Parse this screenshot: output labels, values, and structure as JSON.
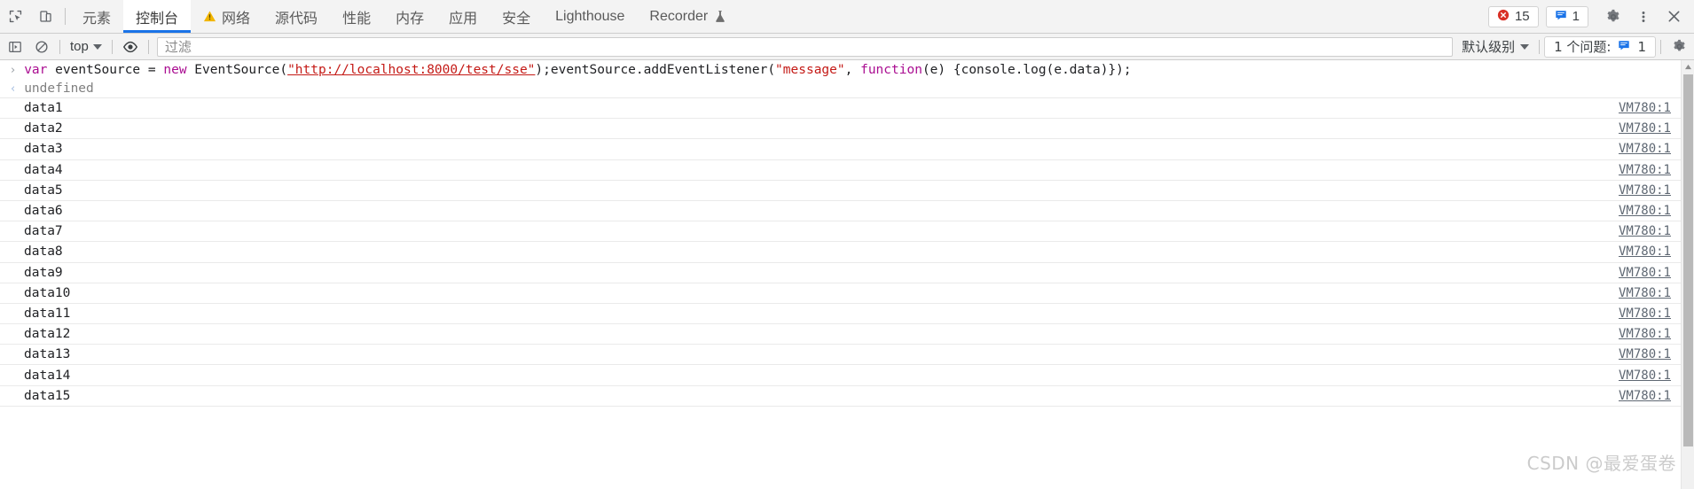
{
  "window": {
    "title": "Chrome DevTools"
  },
  "tabbar": {
    "inspect_icon": "inspect-element-icon",
    "device_icon": "device-toolbar-icon",
    "tabs": [
      {
        "label": "元素",
        "name": "elements",
        "active": false,
        "warning": false,
        "flask": false
      },
      {
        "label": "控制台",
        "name": "console",
        "active": true,
        "warning": false,
        "flask": false
      },
      {
        "label": "网络",
        "name": "network",
        "active": false,
        "warning": true,
        "flask": false
      },
      {
        "label": "源代码",
        "name": "sources",
        "active": false,
        "warning": false,
        "flask": false
      },
      {
        "label": "性能",
        "name": "performance",
        "active": false,
        "warning": false,
        "flask": false
      },
      {
        "label": "内存",
        "name": "memory",
        "active": false,
        "warning": false,
        "flask": false
      },
      {
        "label": "应用",
        "name": "application",
        "active": false,
        "warning": false,
        "flask": false
      },
      {
        "label": "安全",
        "name": "security",
        "active": false,
        "warning": false,
        "flask": false
      },
      {
        "label": "Lighthouse",
        "name": "lighthouse",
        "active": false,
        "warning": false,
        "flask": false
      },
      {
        "label": "Recorder",
        "name": "recorder",
        "active": false,
        "warning": false,
        "flask": true
      }
    ],
    "error_count": "15",
    "message_count": "1",
    "settings_icon": "gear-icon",
    "more_icon": "kebab-menu-icon",
    "close_icon": "close-icon"
  },
  "toolbar": {
    "sidebar_icon": "console-sidebar-icon",
    "clear_icon": "clear-console-icon",
    "context_value": "top",
    "eye_icon": "live-expression-eye-icon",
    "filter_placeholder": "过滤",
    "filter_value": "",
    "level_value": "默认级别",
    "issues_label": "1 个问题:",
    "issues_count": "1",
    "settings_icon": "console-settings-gear-icon"
  },
  "console": {
    "prompt_arrow": "›",
    "return_arrow": "‹",
    "command": {
      "tokens": [
        {
          "t": "var",
          "k": "kw"
        },
        {
          "t": " eventSource = ",
          "k": "plain"
        },
        {
          "t": "new",
          "k": "kw"
        },
        {
          "t": " EventSource(",
          "k": "plain"
        },
        {
          "t": "\"http://localhost:8000/test/sse\"",
          "k": "str-link"
        },
        {
          "t": ");eventSource.addEventListener(",
          "k": "plain"
        },
        {
          "t": "\"message\"",
          "k": "str"
        },
        {
          "t": ", ",
          "k": "plain"
        },
        {
          "t": "function",
          "k": "kw"
        },
        {
          "t": "(e) {console.log(e.data)});",
          "k": "plain"
        }
      ],
      "raw": "var eventSource = new EventSource(\"http://localhost:8000/test/sse\");eventSource.addEventListener(\"message\", function(e) {console.log(e.data)});"
    },
    "result": "undefined",
    "messages": [
      {
        "text": "data1",
        "source": "VM780:1"
      },
      {
        "text": "data2",
        "source": "VM780:1"
      },
      {
        "text": "data3",
        "source": "VM780:1"
      },
      {
        "text": "data4",
        "source": "VM780:1"
      },
      {
        "text": "data5",
        "source": "VM780:1"
      },
      {
        "text": "data6",
        "source": "VM780:1"
      },
      {
        "text": "data7",
        "source": "VM780:1"
      },
      {
        "text": "data8",
        "source": "VM780:1"
      },
      {
        "text": "data9",
        "source": "VM780:1"
      },
      {
        "text": "data10",
        "source": "VM780:1"
      },
      {
        "text": "data11",
        "source": "VM780:1"
      },
      {
        "text": "data12",
        "source": "VM780:1"
      },
      {
        "text": "data13",
        "source": "VM780:1"
      },
      {
        "text": "data14",
        "source": "VM780:1"
      },
      {
        "text": "data15",
        "source": "VM780:1"
      }
    ]
  },
  "watermark": {
    "text": "CSDN @最爱蛋卷"
  },
  "colors": {
    "accent": "#1a73e8",
    "error": "#d93025",
    "warning": "#f2b600",
    "chrome_bg": "#f3f3f3",
    "keyword": "#aa0d91",
    "string": "#c41a16",
    "link": "#5f6873"
  }
}
